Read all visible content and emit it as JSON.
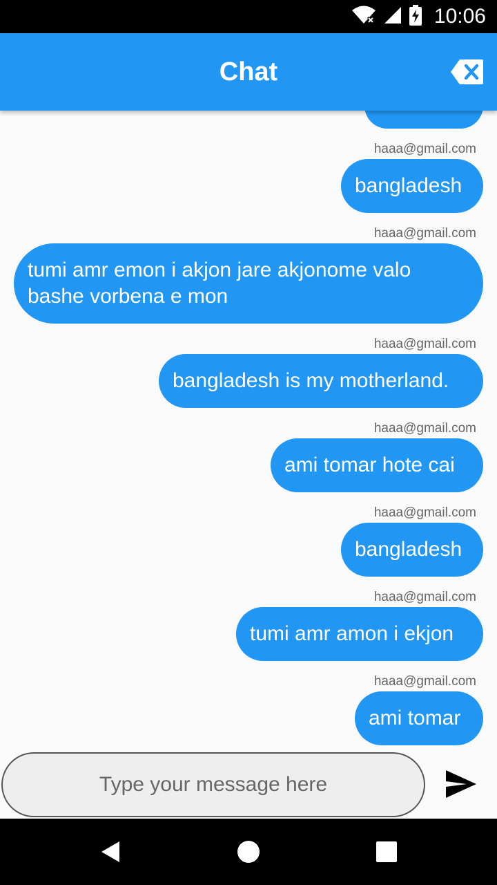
{
  "status_bar": {
    "time": "10:06",
    "icons": [
      "wifi-no-internet-icon",
      "cell-signal-icon",
      "battery-charging-icon"
    ]
  },
  "app_bar": {
    "title": "Chat",
    "clear_icon": "backspace-icon"
  },
  "messages": [
    {
      "sender": "",
      "text": ""
    },
    {
      "sender": "haaa@gmail.com",
      "text": "bangladesh"
    },
    {
      "sender": "haaa@gmail.com",
      "text": "tumi amr emon i akjon jare akjonome valo bashe vorbena e mon"
    },
    {
      "sender": "haaa@gmail.com",
      "text": "bangladesh is my motherland."
    },
    {
      "sender": "haaa@gmail.com",
      "text": "ami tomar hote cai"
    },
    {
      "sender": "haaa@gmail.com",
      "text": "bangladesh"
    },
    {
      "sender": "haaa@gmail.com",
      "text": "tumi amr amon i ekjon"
    },
    {
      "sender": "haaa@gmail.com",
      "text": "ami tomar"
    }
  ],
  "composer": {
    "value": "",
    "placeholder": "Type your message here",
    "send_icon": "send-icon"
  },
  "nav": {
    "icons": [
      "back-icon",
      "home-icon",
      "recents-icon"
    ]
  },
  "colors": {
    "primary": "#2196f3",
    "background": "#fafafa",
    "bubble_text": "#ffffff",
    "sender_text": "#666666"
  }
}
